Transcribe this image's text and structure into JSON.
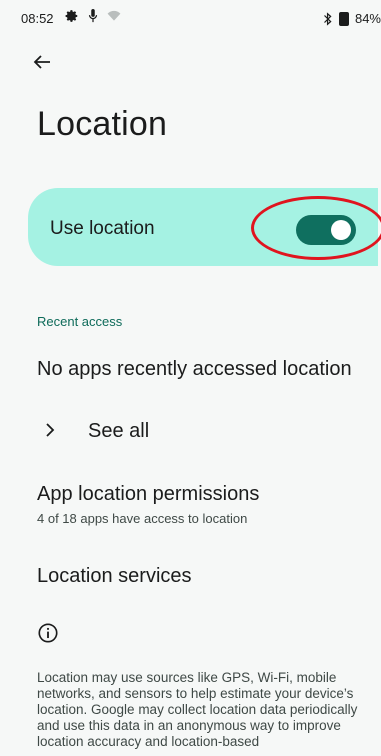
{
  "status_bar": {
    "time": "08:52",
    "battery": "84%",
    "left_icons": [
      "gear-icon",
      "mic-icon",
      "wifi-icon"
    ],
    "right_icons": [
      "bluetooth-icon",
      "battery-icon"
    ]
  },
  "header": {
    "back_icon": "arrow-left-icon",
    "title": "Location"
  },
  "main_toggle": {
    "label": "Use location",
    "enabled": true,
    "colors": {
      "card": "#a5f2e3",
      "track": "#0f6f5f",
      "highlight": "#e0141f"
    }
  },
  "recent_access": {
    "header": "Recent access",
    "empty_message": "No apps recently accessed location",
    "see_all_label": "See all",
    "see_all_icon": "chevron-right-icon"
  },
  "app_permissions": {
    "title": "App location permissions",
    "subtitle": "4 of 18 apps have access to location"
  },
  "services": {
    "title": "Location services"
  },
  "info": {
    "icon": "info-icon",
    "text": "Location may use sources like GPS, Wi-Fi, mobile networks, and sensors to help estimate your device’s location. Google may collect location data periodically and use this data in an anonymous way to improve location accuracy and location-based"
  }
}
